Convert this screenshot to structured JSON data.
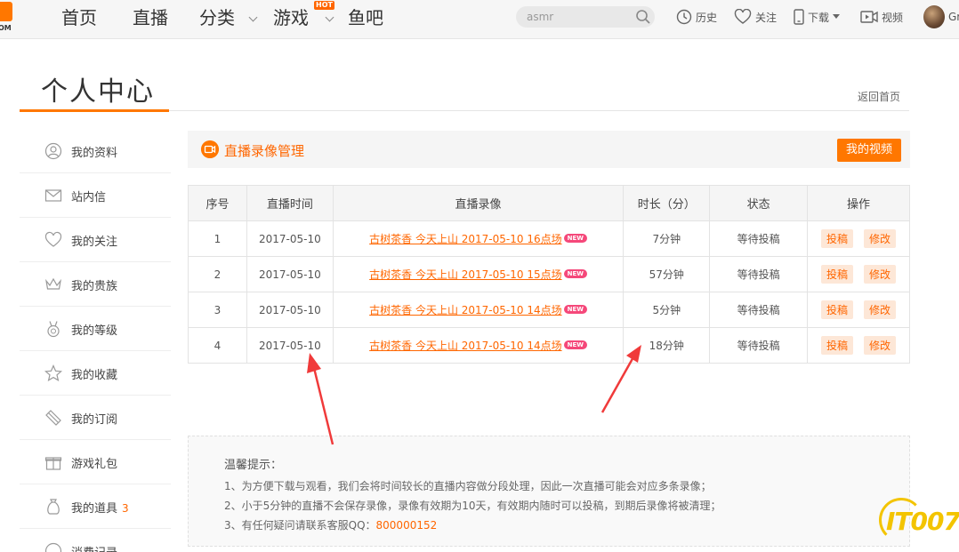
{
  "logo": {
    "sub": "OM"
  },
  "nav": {
    "items": [
      "首页",
      "直播",
      "分类",
      "游戏",
      "鱼吧"
    ],
    "hot_badge": "HOT"
  },
  "search": {
    "value": "asmr"
  },
  "tools": {
    "history": "历史",
    "follow": "关注",
    "download": "下载",
    "video": "视频",
    "user_name": "Gr"
  },
  "page": {
    "title": "个人中心",
    "back_link": "返回首页"
  },
  "sidebar": {
    "items": [
      {
        "label": "我的资料",
        "icon": "user-icon"
      },
      {
        "label": "站内信",
        "icon": "mail-icon"
      },
      {
        "label": "我的关注",
        "icon": "heart-icon"
      },
      {
        "label": "我的贵族",
        "icon": "crown-icon"
      },
      {
        "label": "我的等级",
        "icon": "medal-icon"
      },
      {
        "label": "我的收藏",
        "icon": "star-icon"
      },
      {
        "label": "我的订阅",
        "icon": "subscribe-icon"
      },
      {
        "label": "游戏礼包",
        "icon": "gift-icon"
      },
      {
        "label": "我的道具",
        "icon": "bag-icon",
        "count": "3"
      },
      {
        "label": "消费记录",
        "icon": "record-icon"
      }
    ]
  },
  "panel": {
    "title": "直播录像管理",
    "my_video_button": "我的视频"
  },
  "table": {
    "headers": [
      "序号",
      "直播时间",
      "直播录像",
      "时长（分）",
      "状态",
      "操作"
    ],
    "new_badge": "NEW",
    "action_submit": "投稿",
    "action_edit": "修改",
    "rows": [
      {
        "index": "1",
        "date": "2017-05-10",
        "title": "古树茶香 今天上山 2017-05-10 16点场",
        "duration": "7分钟",
        "status": "等待投稿"
      },
      {
        "index": "2",
        "date": "2017-05-10",
        "title": "古树茶香 今天上山 2017-05-10 15点场",
        "duration": "57分钟",
        "status": "等待投稿"
      },
      {
        "index": "3",
        "date": "2017-05-10",
        "title": "古树茶香 今天上山 2017-05-10 14点场",
        "duration": "5分钟",
        "status": "等待投稿"
      },
      {
        "index": "4",
        "date": "2017-05-10",
        "title": "古树茶香 今天上山 2017-05-10 14点场",
        "duration": "18分钟",
        "status": "等待投稿"
      }
    ]
  },
  "tips": {
    "title": "温馨提示：",
    "line1": "1、为方便下载与观看，我们会将时间较长的直播内容做分段处理，因此一次直播可能会对应多条录像；",
    "line2": "2、小于5分钟的直播不会保存录像，录像有效期为10天，有效期内随时可以投稿，到期后录像将被清理；",
    "line3_prefix": "3、有任何疑问请联系客服QQ：",
    "qq": "800000152"
  },
  "watermark": "IT007",
  "colors": {
    "accent": "#ff7700",
    "badge_new": "#f5487a",
    "annotation_arrow": "#f03a3a"
  }
}
